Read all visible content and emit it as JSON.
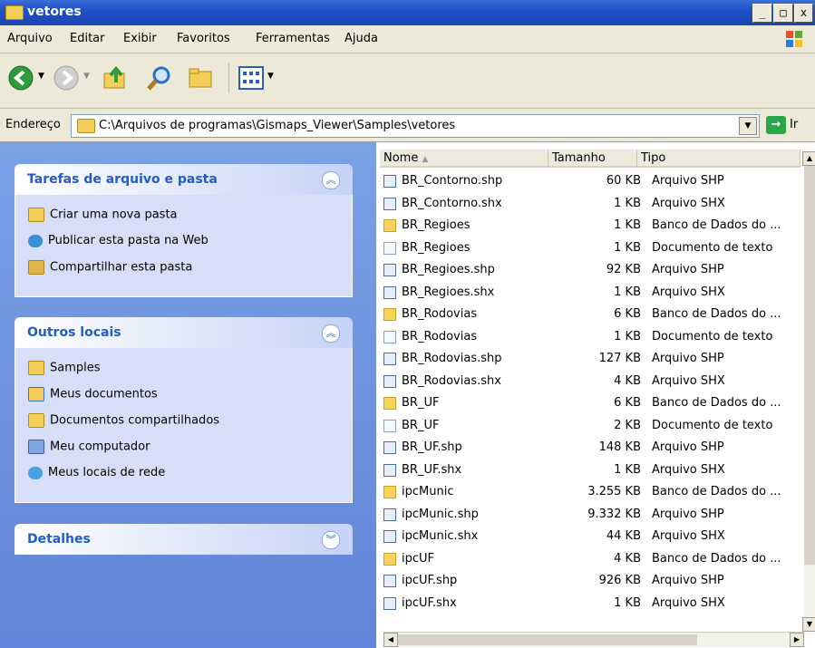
{
  "window": {
    "title": "vetores",
    "min_glyph": "_",
    "max_glyph": "□",
    "close_glyph": "x"
  },
  "menu": [
    "Arquivo",
    "Editar",
    "Exibir",
    "Favoritos",
    "Ferramentas",
    "Ajuda"
  ],
  "address": {
    "label": "Endereço",
    "path": "C:\\Arquivos de programas\\Gismaps_Viewer\\Samples\\vetores",
    "go_label": "Ir"
  },
  "tasks_panel": {
    "title": "Tarefas de arquivo e pasta",
    "items": [
      "Criar uma nova pasta",
      "Publicar esta pasta na Web",
      "Compartilhar esta pasta"
    ]
  },
  "places_panel": {
    "title": "Outros locais",
    "items": [
      "Samples",
      "Meus documentos",
      "Documentos compartilhados",
      "Meu computador",
      "Meus locais de rede"
    ]
  },
  "details_panel": {
    "title": "Detalhes"
  },
  "columns": {
    "name": "Nome",
    "size": "Tamanho",
    "type": "Tipo"
  },
  "files": [
    {
      "name": "BR_Contorno.shp",
      "size": "60 KB",
      "type": "Arquivo SHP",
      "kind": "shp"
    },
    {
      "name": "BR_Contorno.shx",
      "size": "1 KB",
      "type": "Arquivo SHX",
      "kind": "shp"
    },
    {
      "name": "BR_Regioes",
      "size": "1 KB",
      "type": "Banco de Dados do ...",
      "kind": "db"
    },
    {
      "name": "BR_Regioes",
      "size": "1 KB",
      "type": "Documento de texto",
      "kind": "txt"
    },
    {
      "name": "BR_Regioes.shp",
      "size": "92 KB",
      "type": "Arquivo SHP",
      "kind": "shp"
    },
    {
      "name": "BR_Regioes.shx",
      "size": "1 KB",
      "type": "Arquivo SHX",
      "kind": "shp"
    },
    {
      "name": "BR_Rodovias",
      "size": "6 KB",
      "type": "Banco de Dados do ...",
      "kind": "db"
    },
    {
      "name": "BR_Rodovias",
      "size": "1 KB",
      "type": "Documento de texto",
      "kind": "txt"
    },
    {
      "name": "BR_Rodovias.shp",
      "size": "127 KB",
      "type": "Arquivo SHP",
      "kind": "shp"
    },
    {
      "name": "BR_Rodovias.shx",
      "size": "4 KB",
      "type": "Arquivo SHX",
      "kind": "shp"
    },
    {
      "name": "BR_UF",
      "size": "6 KB",
      "type": "Banco de Dados do ...",
      "kind": "db"
    },
    {
      "name": "BR_UF",
      "size": "2 KB",
      "type": "Documento de texto",
      "kind": "txt"
    },
    {
      "name": "BR_UF.shp",
      "size": "148 KB",
      "type": "Arquivo SHP",
      "kind": "shp"
    },
    {
      "name": "BR_UF.shx",
      "size": "1 KB",
      "type": "Arquivo SHX",
      "kind": "shp"
    },
    {
      "name": "ipcMunic",
      "size": "3.255 KB",
      "type": "Banco de Dados do ...",
      "kind": "db"
    },
    {
      "name": "ipcMunic.shp",
      "size": "9.332 KB",
      "type": "Arquivo SHP",
      "kind": "shp"
    },
    {
      "name": "ipcMunic.shx",
      "size": "44 KB",
      "type": "Arquivo SHX",
      "kind": "shp"
    },
    {
      "name": "ipcUF",
      "size": "4 KB",
      "type": "Banco de Dados do ...",
      "kind": "db"
    },
    {
      "name": "ipcUF.shp",
      "size": "926 KB",
      "type": "Arquivo SHP",
      "kind": "shp"
    },
    {
      "name": "ipcUF.shx",
      "size": "1 KB",
      "type": "Arquivo SHX",
      "kind": "shp"
    }
  ]
}
